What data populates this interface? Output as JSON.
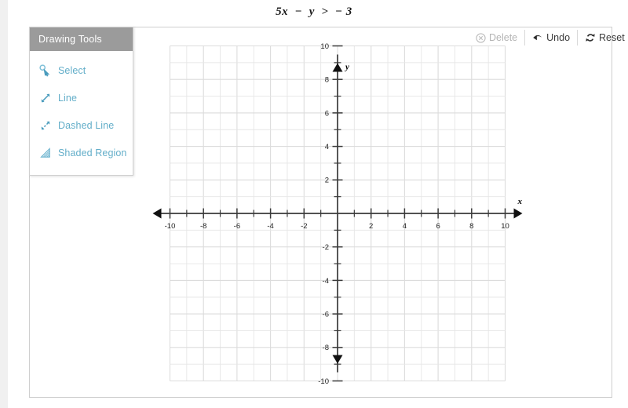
{
  "title": "5x  −  y  >  − 3",
  "tools_panel": {
    "header": "Drawing Tools",
    "items": [
      {
        "label": "Select",
        "icon": "cursor-icon"
      },
      {
        "label": "Line",
        "icon": "line-arrow-icon"
      },
      {
        "label": "Dashed Line",
        "icon": "dashed-line-arrow-icon"
      },
      {
        "label": "Shaded Region",
        "icon": "shaded-region-icon"
      }
    ]
  },
  "actions": [
    {
      "label": "Delete",
      "icon": "circle-x-icon",
      "enabled": false
    },
    {
      "label": "Undo",
      "icon": "undo-arrow-icon",
      "enabled": true
    },
    {
      "label": "Reset",
      "icon": "refresh-icon",
      "enabled": true
    }
  ],
  "colors": {
    "tool_text": "#63aec9",
    "panel_header_bg": "#9b9b9b",
    "grid_line": "#e6e6e6",
    "grid_major": "#dcdcdc",
    "axis": "#3a3a3a",
    "frame_border": "#cfcfcf",
    "disabled_text": "#b4b4b4"
  },
  "chart_data": {
    "type": "scatter",
    "title": "5x − y > −3",
    "xlabel": "x",
    "ylabel": "y",
    "xlim": [
      -10,
      10
    ],
    "ylim": [
      -10,
      10
    ],
    "x_tick_labels": [
      -10,
      -8,
      -6,
      -4,
      -2,
      2,
      4,
      6,
      8,
      10
    ],
    "y_tick_labels": [
      10,
      8,
      6,
      4,
      2,
      -2,
      -4,
      -6,
      -8,
      -10
    ],
    "tick_step": 1,
    "major_tick_step": 2,
    "grid": true,
    "legend": null,
    "series": [],
    "annotations": []
  }
}
